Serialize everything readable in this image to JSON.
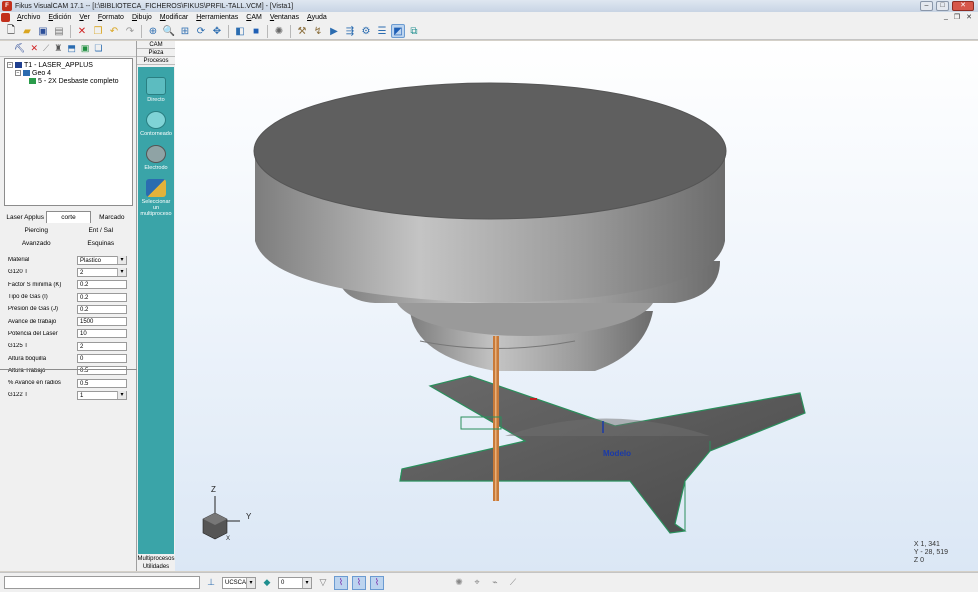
{
  "window": {
    "title": "Fikus VisualCAM 17.1  -- [I:\\BIBLIOTECA_FICHEROS\\FIKUS\\PRFIL-TALL.VCM] - [Vista1]"
  },
  "menu": {
    "items": [
      "Archivo",
      "Edición",
      "Ver",
      "Formato",
      "Dibujo",
      "Modificar",
      "Herramientas",
      "CAM",
      "Ventanas",
      "Ayuda"
    ]
  },
  "tree": {
    "nodes": [
      {
        "label": "T1 - LASER_APPLUS",
        "level": 0
      },
      {
        "label": "Geo 4",
        "level": 1
      },
      {
        "label": "5 - 2X Desbaste completo",
        "level": 2
      }
    ]
  },
  "tabs": {
    "row1": [
      "Laser Applus",
      "corte",
      "Marcado"
    ],
    "row2": [
      "Piercing",
      "Ent / Sal"
    ],
    "row3": [
      "Avanzado",
      "Esquinas"
    ],
    "active": "corte"
  },
  "params": [
    {
      "label": "Material",
      "value": "Plastico",
      "dropdown": true
    },
    {
      "label": "G120 T",
      "value": "2",
      "dropdown": true
    },
    {
      "label": "Factor S minima (K)",
      "value": "0.2",
      "dropdown": false
    },
    {
      "label": "Tipo de Gas     (I)",
      "value": "0.2",
      "dropdown": false
    },
    {
      "label": "Presion de Gas   (J)",
      "value": "0.2",
      "dropdown": false
    },
    {
      "label": "Avance de trabajo",
      "value": "1500",
      "dropdown": false
    },
    {
      "label": "Potencia del Laser",
      "value": "10",
      "dropdown": false
    },
    {
      "label": "G125 T",
      "value": "2",
      "dropdown": false
    },
    {
      "label": "Altura boquilla",
      "value": "0",
      "dropdown": false
    },
    {
      "label": "Altura Trabajo",
      "value": "0.5",
      "dropdown": false
    },
    {
      "label": "% Avance en radios",
      "value": "0.5",
      "dropdown": false
    },
    {
      "label": "G122 T",
      "value": "1",
      "dropdown": true
    }
  ],
  "cam": {
    "top_tabs": [
      "CAM",
      "Pieza",
      "Procesos"
    ],
    "tools": [
      {
        "label": "Directo",
        "icon": "direct-process-icon"
      },
      {
        "label": "Contorneado",
        "icon": "contour-process-icon"
      },
      {
        "label": "Electrodo",
        "icon": "electrode-gear-icon"
      },
      {
        "label": "Seleccionar un multiproceso",
        "icon": "multiprocess-select-icon"
      }
    ],
    "bottom_tabs": [
      "Multiprocesos",
      "Utilidades"
    ]
  },
  "viewport": {
    "model_label": "Modelo",
    "axis_labels": {
      "x": "X",
      "y": "Y",
      "z": "Z"
    },
    "coords": [
      "X  1, 341",
      "Y  - 28, 519",
      "Z  0"
    ]
  },
  "status": {
    "ucs_value": "UCSCAM",
    "layer_value": "0"
  }
}
